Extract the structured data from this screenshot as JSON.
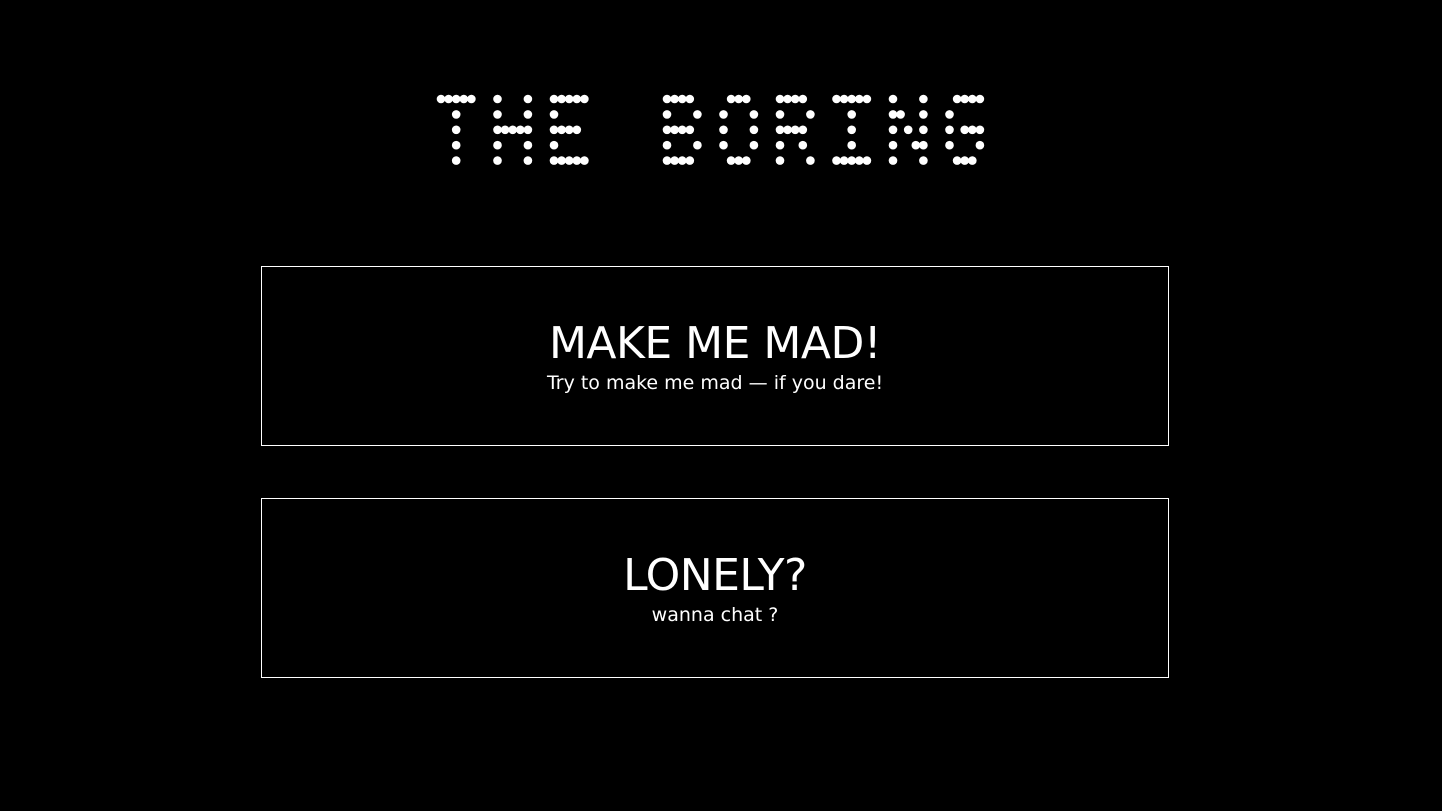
{
  "header": {
    "logo_text": "THE BORING"
  },
  "cards": [
    {
      "title": "MAKE ME MAD!",
      "subtitle": "Try to make me mad — if you dare!"
    },
    {
      "title": "LONELY?",
      "subtitle": "wanna chat ?"
    }
  ],
  "colors": {
    "background": "#000000",
    "foreground": "#ffffff",
    "border": "#ffffff"
  }
}
